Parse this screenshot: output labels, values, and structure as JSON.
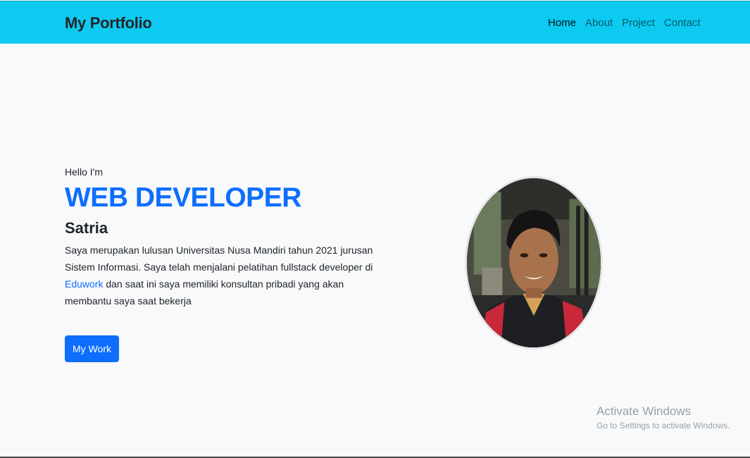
{
  "navbar": {
    "brand": "My Portfolio",
    "links": [
      {
        "label": "Home",
        "active": true
      },
      {
        "label": "About",
        "active": false
      },
      {
        "label": "Project",
        "active": false
      },
      {
        "label": "Contact",
        "active": false
      }
    ]
  },
  "hero": {
    "greeting": "Hello I'm",
    "role": "WEB DEVELOPER",
    "name": "Satria",
    "bio_before_link": "Saya merupakan lulusan Universitas Nusa Mandiri tahun 2021 jurusan Sistem Informasi. Saya telah menjalani pelatihan fullstack developer di ",
    "bio_link": "Eduwork",
    "bio_after_link": " dan saat ini saya memiliki konsultan pribadi yang akan membantu saya saat bekerja",
    "button_label": "My Work",
    "photo_alt": "profile photo"
  },
  "watermark": {
    "title": "Activate Windows",
    "subtitle": "Go to Settings to activate Windows."
  },
  "colors": {
    "navbar_bg": "#0dcaf0",
    "primary": "#0d6efd",
    "page_bg": "#f8f9fa"
  }
}
